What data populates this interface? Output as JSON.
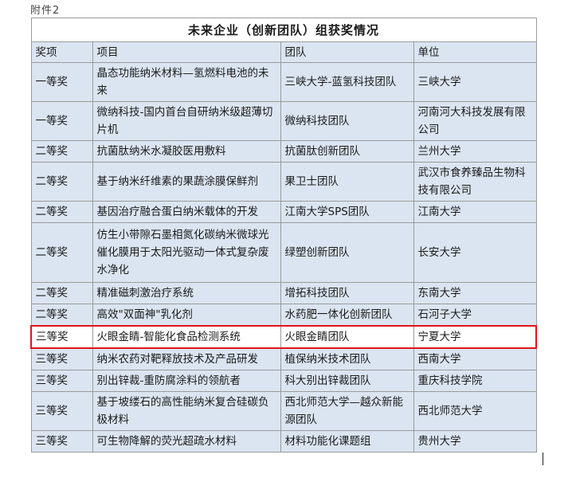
{
  "attachment_label": "附件2",
  "table": {
    "title": "未来企业（创新团队）组获奖情况",
    "headers": [
      "奖项",
      "项目",
      "团队",
      "单位"
    ],
    "rows": [
      {
        "award": "一等奖",
        "project": "晶态功能纳米材料—氢燃料电池的未来",
        "team": "三峡大学-蓝氢科技团队",
        "unit": "三峡大学"
      },
      {
        "award": "一等奖",
        "project": "微纳科技-国内首台自研纳米级超薄切片机",
        "team": "微纳科技团队",
        "unit": "河南河大科技发展有限公司"
      },
      {
        "award": "二等奖",
        "project": "抗菌肽纳米水凝胶医用敷料",
        "team": "抗菌肽创新团队",
        "unit": "兰州大学"
      },
      {
        "award": "二等奖",
        "project": "基于纳米纤维素的果蔬涂膜保鲜剂",
        "team": "果卫士团队",
        "unit": "武汉市食养臻品生物科技有限公司"
      },
      {
        "award": "二等奖",
        "project": "基因治疗融合蛋白纳米载体的开发",
        "team": "江南大学SPS团队",
        "unit": "江南大学"
      },
      {
        "award": "二等奖",
        "project": "仿生小带隙石墨相氮化碳纳米微球光催化膜用于太阳光驱动一体式复杂废水净化",
        "team": "绿塑创新团队",
        "unit": "长安大学"
      },
      {
        "award": "二等奖",
        "project": "精准磁刺激治疗系统",
        "team": "增拓科技团队",
        "unit": "东南大学"
      },
      {
        "award": "二等奖",
        "project": "高效\"双面神\"乳化剂",
        "team": "水药肥一体化创新团队",
        "unit": "石河子大学"
      },
      {
        "award": "三等奖",
        "project": "火眼金睛-智能化食品检测系统",
        "team": "火眼金睛团队",
        "unit": "宁夏大学"
      },
      {
        "award": "三等奖",
        "project": "纳米农药对靶释放技术及产品研发",
        "team": "植保纳米技术团队",
        "unit": "西南大学"
      },
      {
        "award": "三等奖",
        "project": "别出锌裁-重防腐涂料的领航者",
        "team": "科大别出锌裁团队",
        "unit": "重庆科技学院"
      },
      {
        "award": "三等奖",
        "project": "基于坡缕石的高性能纳米复合硅碳负极材料",
        "team": "西北师范大学—越众新能源团队",
        "unit": "西北师范大学"
      },
      {
        "award": "三等奖",
        "project": "可生物降解的荧光超疏水材料",
        "team": "材料功能化课题组",
        "unit": "贵州大学"
      }
    ]
  },
  "colors": {
    "row_fill": "#dbe5f1",
    "highlight_border": "#e0161b",
    "grid": "#9a9a9a"
  }
}
